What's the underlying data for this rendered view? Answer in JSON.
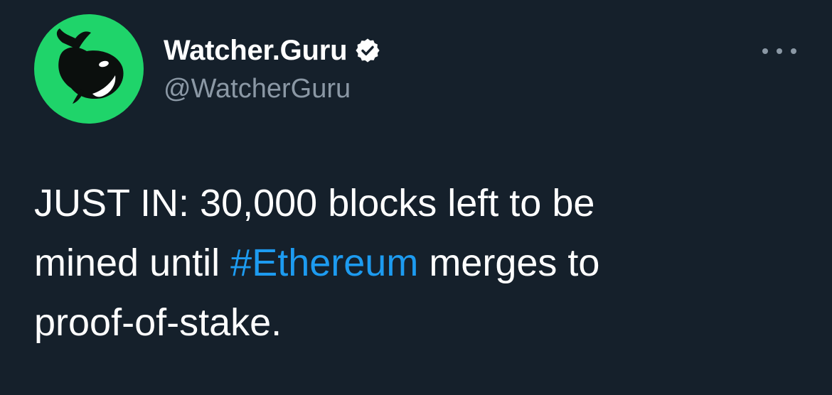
{
  "author": {
    "display_name": "Watcher.Guru",
    "handle": "@WatcherGuru",
    "verified_icon": "verified-badge-icon",
    "avatar_icon": "orca-whale-logo",
    "avatar_color": "#1fd46a"
  },
  "more_icon": "more-horizontal-icon",
  "tweet": {
    "line1": "JUST IN: 30,000 blocks left to be",
    "line2_before": "mined until ",
    "hashtag": "#Ethereum",
    "line2_after": " merges to",
    "line3": "proof-of-stake."
  },
  "colors": {
    "background": "#15202b",
    "text": "#ffffff",
    "secondary_text": "#8b98a5",
    "link": "#1d9bf0"
  }
}
